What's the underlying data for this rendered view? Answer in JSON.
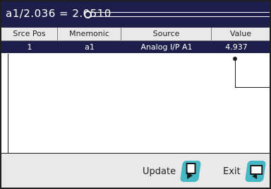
{
  "title": "a1/2.036 = 2.0510",
  "columns": {
    "srce_pos": "Srce Pos",
    "mnemonic": "Mnemonic",
    "source": "Source",
    "value": "Value"
  },
  "rows": [
    {
      "srce_pos": "1",
      "mnemonic": "a1",
      "source": "Analog I/P A1",
      "value": "4.937"
    }
  ],
  "footer": {
    "update_label": "Update",
    "exit_label": "Exit"
  },
  "icons": {
    "update": "update-document-icon",
    "exit": "exit-icon"
  },
  "colors": {
    "titlebar": "#1d1f4a",
    "selected_row": "#1d1f4a",
    "icon_accent": "#46b7c4",
    "panel_bg": "#e9e9e9"
  }
}
